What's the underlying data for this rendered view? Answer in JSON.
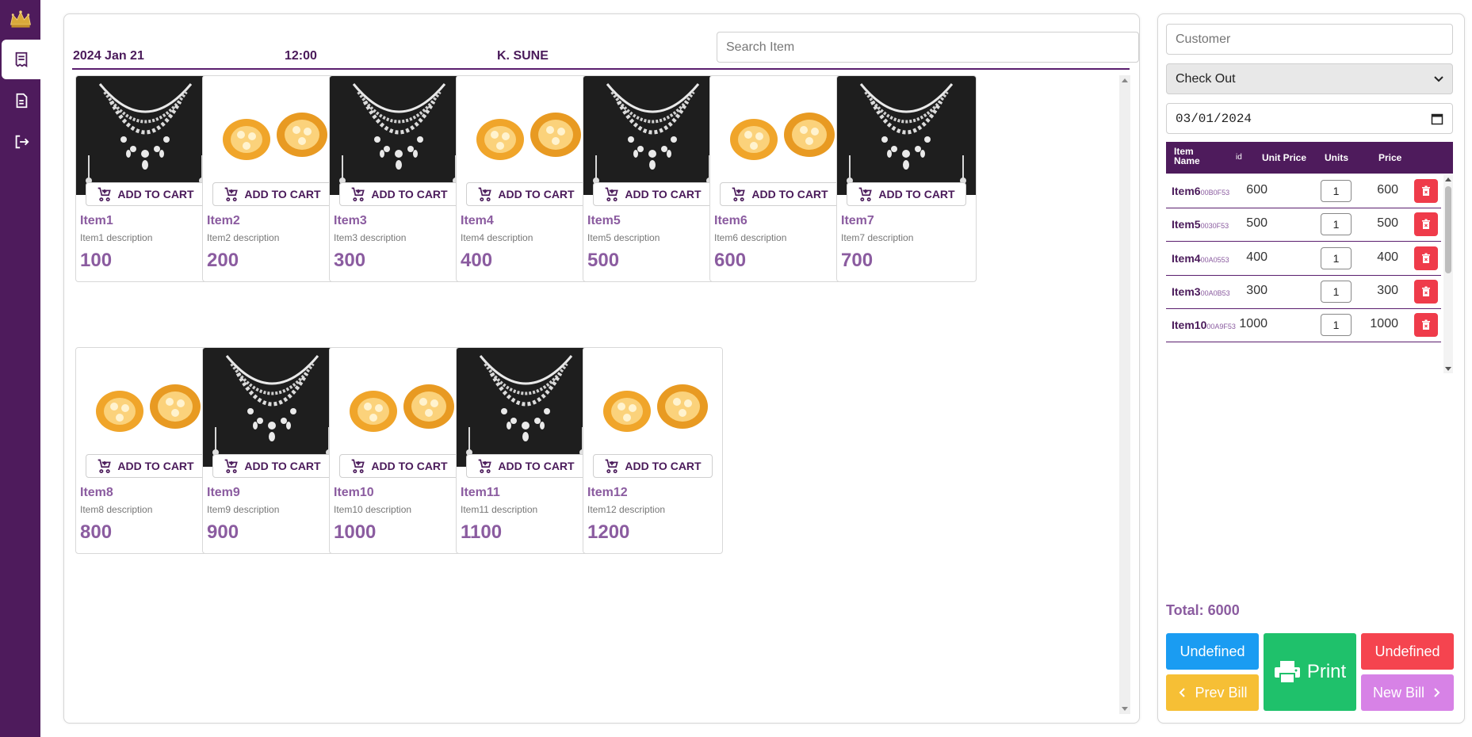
{
  "header": {
    "date": "2024 Jan 21",
    "time": "12:00",
    "user": "K. SUNE",
    "search_placeholder": "Search Item"
  },
  "sidebar": {
    "items": [
      {
        "icon": "receipt-icon",
        "active": true
      },
      {
        "icon": "document-icon",
        "active": false
      },
      {
        "icon": "logout-icon",
        "active": false
      }
    ]
  },
  "products": [
    {
      "name": "Item1",
      "description": "Item1 description",
      "price": "100",
      "image": "necklace"
    },
    {
      "name": "Item2",
      "description": "Item2 description",
      "price": "200",
      "image": "earrings"
    },
    {
      "name": "Item3",
      "description": "Item3 description",
      "price": "300",
      "image": "necklace"
    },
    {
      "name": "Item4",
      "description": "Item4 description",
      "price": "400",
      "image": "earrings"
    },
    {
      "name": "Item5",
      "description": "Item5 description",
      "price": "500",
      "image": "necklace"
    },
    {
      "name": "Item6",
      "description": "Item6 description",
      "price": "600",
      "image": "earrings"
    },
    {
      "name": "Item7",
      "description": "Item7 description",
      "price": "700",
      "image": "necklace"
    },
    {
      "name": "Item8",
      "description": "Item8 description",
      "price": "800",
      "image": "earrings"
    },
    {
      "name": "Item9",
      "description": "Item9 description",
      "price": "900",
      "image": "necklace"
    },
    {
      "name": "Item10",
      "description": "Item10 description",
      "price": "1000",
      "image": "earrings"
    },
    {
      "name": "Item11",
      "description": "Item11 description",
      "price": "1100",
      "image": "necklace"
    },
    {
      "name": "Item12",
      "description": "Item12 description",
      "price": "1200",
      "image": "earrings"
    }
  ],
  "add_to_cart_label": "ADD TO CART",
  "bill": {
    "customer_placeholder": "Customer",
    "status_selected": "Check Out",
    "date": "03/01/2024",
    "columns": {
      "item_name": "Item Name",
      "id": "id",
      "unit_price": "Unit Price",
      "units": "Units",
      "price": "Price"
    },
    "rows": [
      {
        "name": "Item6",
        "id": "00B0F53",
        "unit_price": "600",
        "units": "1",
        "price": "600"
      },
      {
        "name": "Item5",
        "id": "0030F53",
        "unit_price": "500",
        "units": "1",
        "price": "500"
      },
      {
        "name": "Item4",
        "id": "00A0553",
        "unit_price": "400",
        "units": "1",
        "price": "400"
      },
      {
        "name": "Item3",
        "id": "00A0B53",
        "unit_price": "300",
        "units": "1",
        "price": "300"
      },
      {
        "name": "Item10",
        "id": "00A9F53",
        "unit_price": "1000",
        "units": "1",
        "price": "1000"
      }
    ],
    "total_label": "Total: 6000",
    "buttons": {
      "undefined_blue": "Undefined",
      "undefined_red": "Undefined",
      "print": "Print",
      "prev_bill": "Prev Bill",
      "new_bill": "New Bill"
    }
  },
  "colors": {
    "brand_purple": "#4e1b5c",
    "accent_purple": "#8b5ca0",
    "blue": "#1a9cf2",
    "yellow": "#f6bf35",
    "green": "#1fc16b",
    "red": "#f5444f",
    "pink": "#d782e6"
  }
}
